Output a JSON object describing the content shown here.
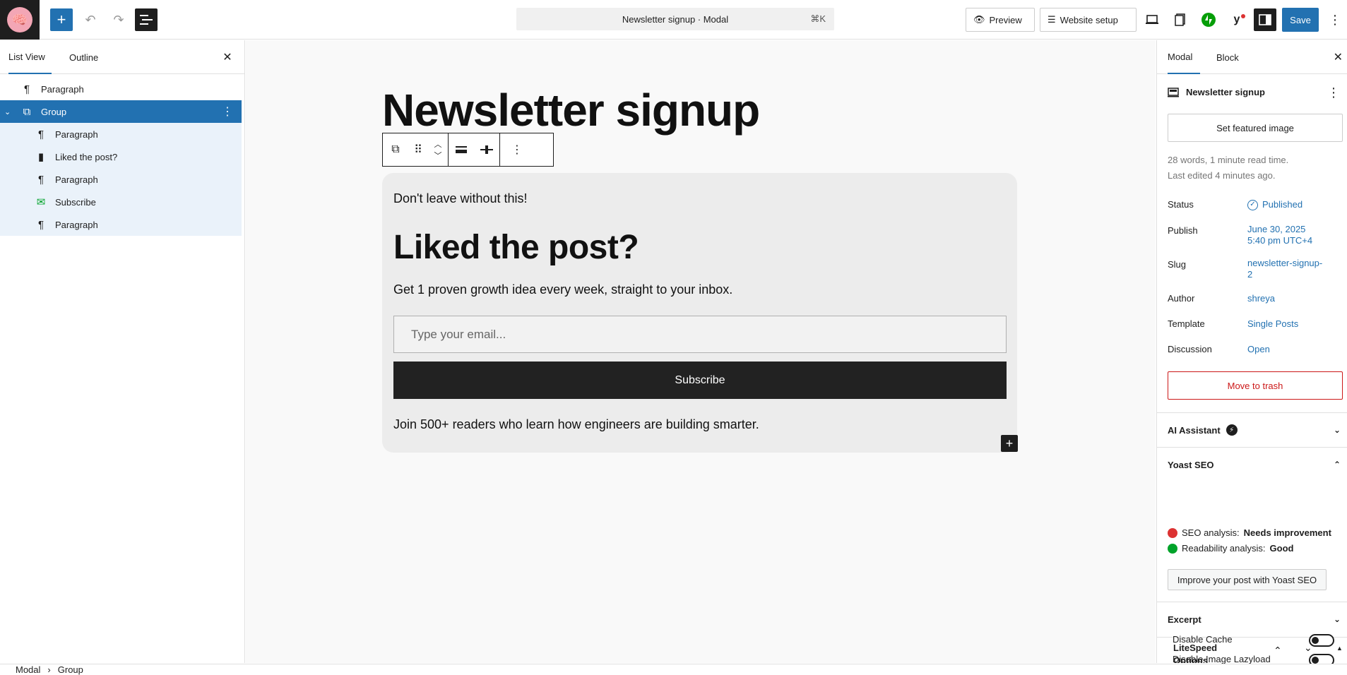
{
  "topbar": {
    "command_text": "Newsletter signup · Modal",
    "command_shortcut": "⌘K",
    "preview_label": "Preview",
    "website_setup_label": "Website setup",
    "save_label": "Save"
  },
  "left_panel": {
    "tabs": [
      {
        "label": "List View"
      },
      {
        "label": "Outline"
      }
    ],
    "tree": [
      {
        "label": "Paragraph",
        "icon": "paragraph-icon"
      },
      {
        "label": "Group",
        "icon": "group-icon"
      },
      {
        "label": "Paragraph",
        "icon": "paragraph-icon"
      },
      {
        "label": "Liked the post?",
        "icon": "bookmark-icon"
      },
      {
        "label": "Paragraph",
        "icon": "paragraph-icon"
      },
      {
        "label": "Subscribe",
        "icon": "envelope-icon"
      },
      {
        "label": "Paragraph",
        "icon": "paragraph-icon"
      }
    ]
  },
  "canvas": {
    "page_title": "Newsletter signup",
    "intro_text": "Don't leave without this!",
    "heading": "Liked the post?",
    "subtext": "Get 1 proven growth idea every week, straight to your inbox.",
    "email_placeholder": "Type your email...",
    "subscribe_label": "Subscribe",
    "footer_text": "Join 500+ readers who learn how engineers are building smarter."
  },
  "right_panel": {
    "tabs": [
      {
        "label": "Modal"
      },
      {
        "label": "Block"
      }
    ],
    "post_title": "Newsletter signup",
    "featured_image_label": "Set featured image",
    "word_count": "28 words, 1 minute read time.",
    "last_edited": "Last edited 4 minutes ago.",
    "properties": {
      "status_label": "Status",
      "status_value": "Published",
      "publish_label": "Publish",
      "publish_value_line1": "June 30, 2025",
      "publish_value_line2": "5:40 pm UTC+4",
      "slug_label": "Slug",
      "slug_value_line1": "newsletter-signup-",
      "slug_value_line2": "2",
      "author_label": "Author",
      "author_value": "shreya",
      "template_label": "Template",
      "template_value": "Single Posts",
      "discussion_label": "Discussion",
      "discussion_value": "Open"
    },
    "trash_label": "Move to trash",
    "ai_assistant_label": "AI Assistant",
    "yoast_label": "Yoast SEO",
    "seo_analysis_label": "SEO analysis:",
    "seo_analysis_value": "Needs improvement",
    "readability_label": "Readability analysis:",
    "readability_value": "Good",
    "improve_label": "Improve your post with Yoast SEO",
    "excerpt_label": "Excerpt",
    "litespeed_line1": "LiteSpeed",
    "litespeed_line2": "Options",
    "disable_cache_label": "Disable Cache",
    "disable_lazyload_label": "Disable Image Lazyload"
  },
  "breadcrumb": {
    "items": [
      "Modal",
      "Group"
    ],
    "separator": "›"
  },
  "colors": {
    "accent": "#2271b1",
    "danger": "#cc1818",
    "seo_bad": "#dc3232",
    "seo_good": "#00a32a"
  }
}
